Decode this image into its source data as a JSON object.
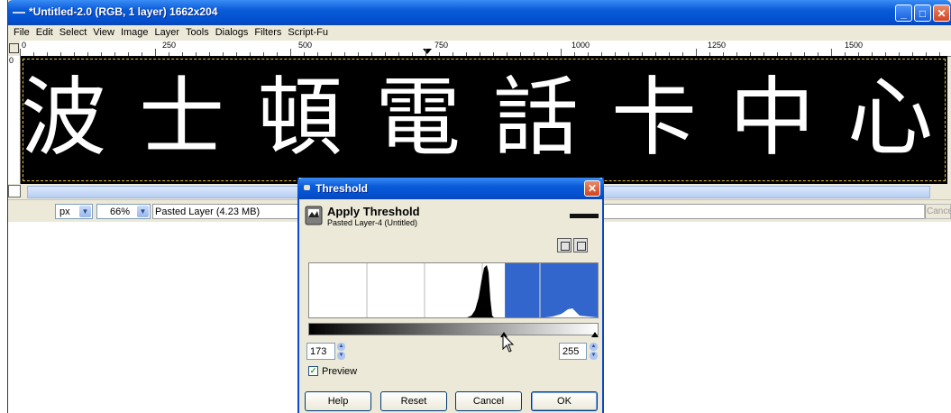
{
  "window": {
    "title": "*Untitled-2.0 (RGB, 1 layer) 1662x204",
    "buttons": [
      "minimize-icon",
      "maximize-icon",
      "close-icon"
    ]
  },
  "menu": [
    "File",
    "Edit",
    "Select",
    "View",
    "Image",
    "Layer",
    "Tools",
    "Dialogs",
    "Filters",
    "Script-Fu"
  ],
  "ruler": {
    "h_labels": [
      "0",
      "250",
      "500",
      "750",
      "1000",
      "1250",
      "1500"
    ],
    "v_label": "0"
  },
  "canvas": {
    "text": "波士頓電話卡中心",
    "background": "#000000",
    "foreground": "#ffffff"
  },
  "statusbar": {
    "unit": "px",
    "zoom": "66%",
    "layer_info": "Pasted Layer (4.23 MB)",
    "cancel_label": "Cance"
  },
  "dialog": {
    "title": "Threshold",
    "header_title": "Apply Threshold",
    "header_subtitle": "Pasted Layer-4 (Untitled)",
    "low_value": "173",
    "high_value": "255",
    "threshold_range": [
      173,
      255
    ],
    "preview_label": "Preview",
    "preview_checked": true,
    "buttons": {
      "help": "Help",
      "reset": "Reset",
      "cancel": "Cancel",
      "ok": "OK"
    },
    "selection_color": "#3366cc"
  }
}
